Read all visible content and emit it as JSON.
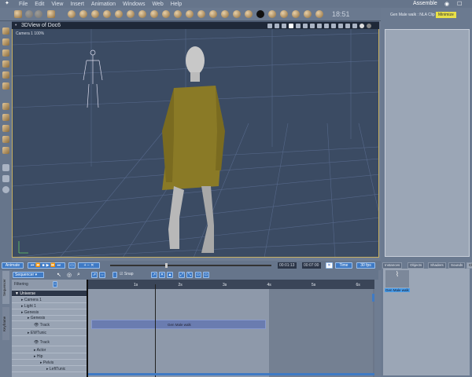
{
  "menu": [
    "File",
    "Edit",
    "View",
    "Insert",
    "Animation",
    "Windows",
    "Web",
    "Help"
  ],
  "clock": "18:51",
  "workspace": "Assemble",
  "window_controls": "◉ ☐ ✕",
  "viewport": {
    "title": "3DView of Doc6",
    "camera_label": "Camera 1 100%"
  },
  "right_panel": {
    "title": "Gen Male walk : NLA Clip",
    "minimize": "Minimize"
  },
  "anim": {
    "animate": "Animate",
    "current_time": "00:01:13",
    "end_time": "00:07:00",
    "time_mode": "Time",
    "fps": "30 fps"
  },
  "sequencer": {
    "mode": "Sequencer",
    "filtering": "Filtering",
    "snap": "Snap",
    "vertical_tabs": [
      "Sequencer",
      "Keyframe"
    ]
  },
  "ruler": [
    "1s",
    "2s",
    "3s",
    "4s",
    "5s",
    "6s"
  ],
  "tree": [
    {
      "label": "Universe",
      "depth": 0,
      "header": true
    },
    {
      "label": "Camera 1",
      "depth": 1
    },
    {
      "label": "Light 1",
      "depth": 1
    },
    {
      "label": "Genesis",
      "depth": 1
    },
    {
      "label": "Genesis",
      "depth": 2
    },
    {
      "label": "Track",
      "depth": 3,
      "track": true
    },
    {
      "label": "EWTunic",
      "depth": 2
    },
    {
      "label": "Track",
      "depth": 3,
      "track": true
    },
    {
      "label": "Actor",
      "depth": 3
    },
    {
      "label": "Hip",
      "depth": 3
    },
    {
      "label": "Pelvis",
      "depth": 4
    },
    {
      "label": "LeftTunic",
      "depth": 5
    }
  ],
  "clip_label": "Gen Male walk",
  "tabs": [
    "Instances",
    "Objects",
    "Shaders",
    "Sounds",
    "Clips"
  ],
  "clips": [
    {
      "label": "Gen Male walk"
    }
  ],
  "colors": {
    "accent": "#3f7ac4",
    "highlight": "#e8e048",
    "viewport": "#3b4b63",
    "dress": "#8a7a26"
  }
}
